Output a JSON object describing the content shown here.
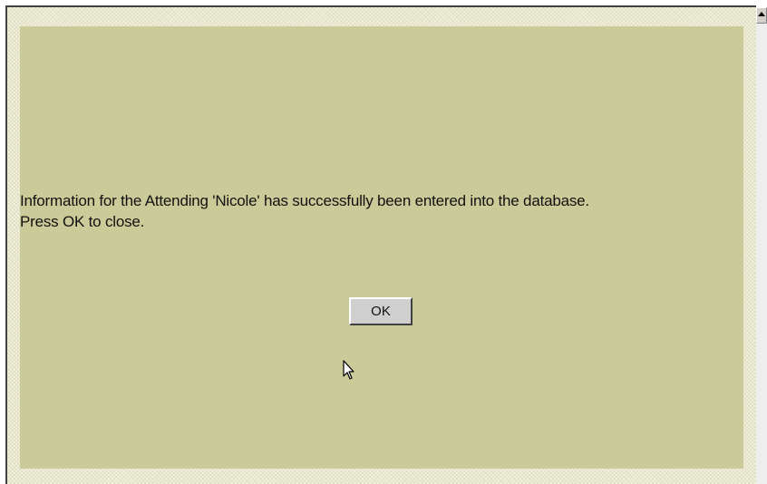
{
  "dialog": {
    "message_line1": "Information for the Attending 'Nicole' has successfully been entered into the database.",
    "message_line2": "Press OK to close.",
    "ok_label": "OK"
  },
  "colors": {
    "panel_background": "#cbcb99",
    "frame_background": "#f1f0dc",
    "button_face": "#cfcfcf"
  },
  "icons": {
    "scroll_up": "scroll-up-arrow-icon",
    "cursor": "mouse-pointer-icon"
  }
}
